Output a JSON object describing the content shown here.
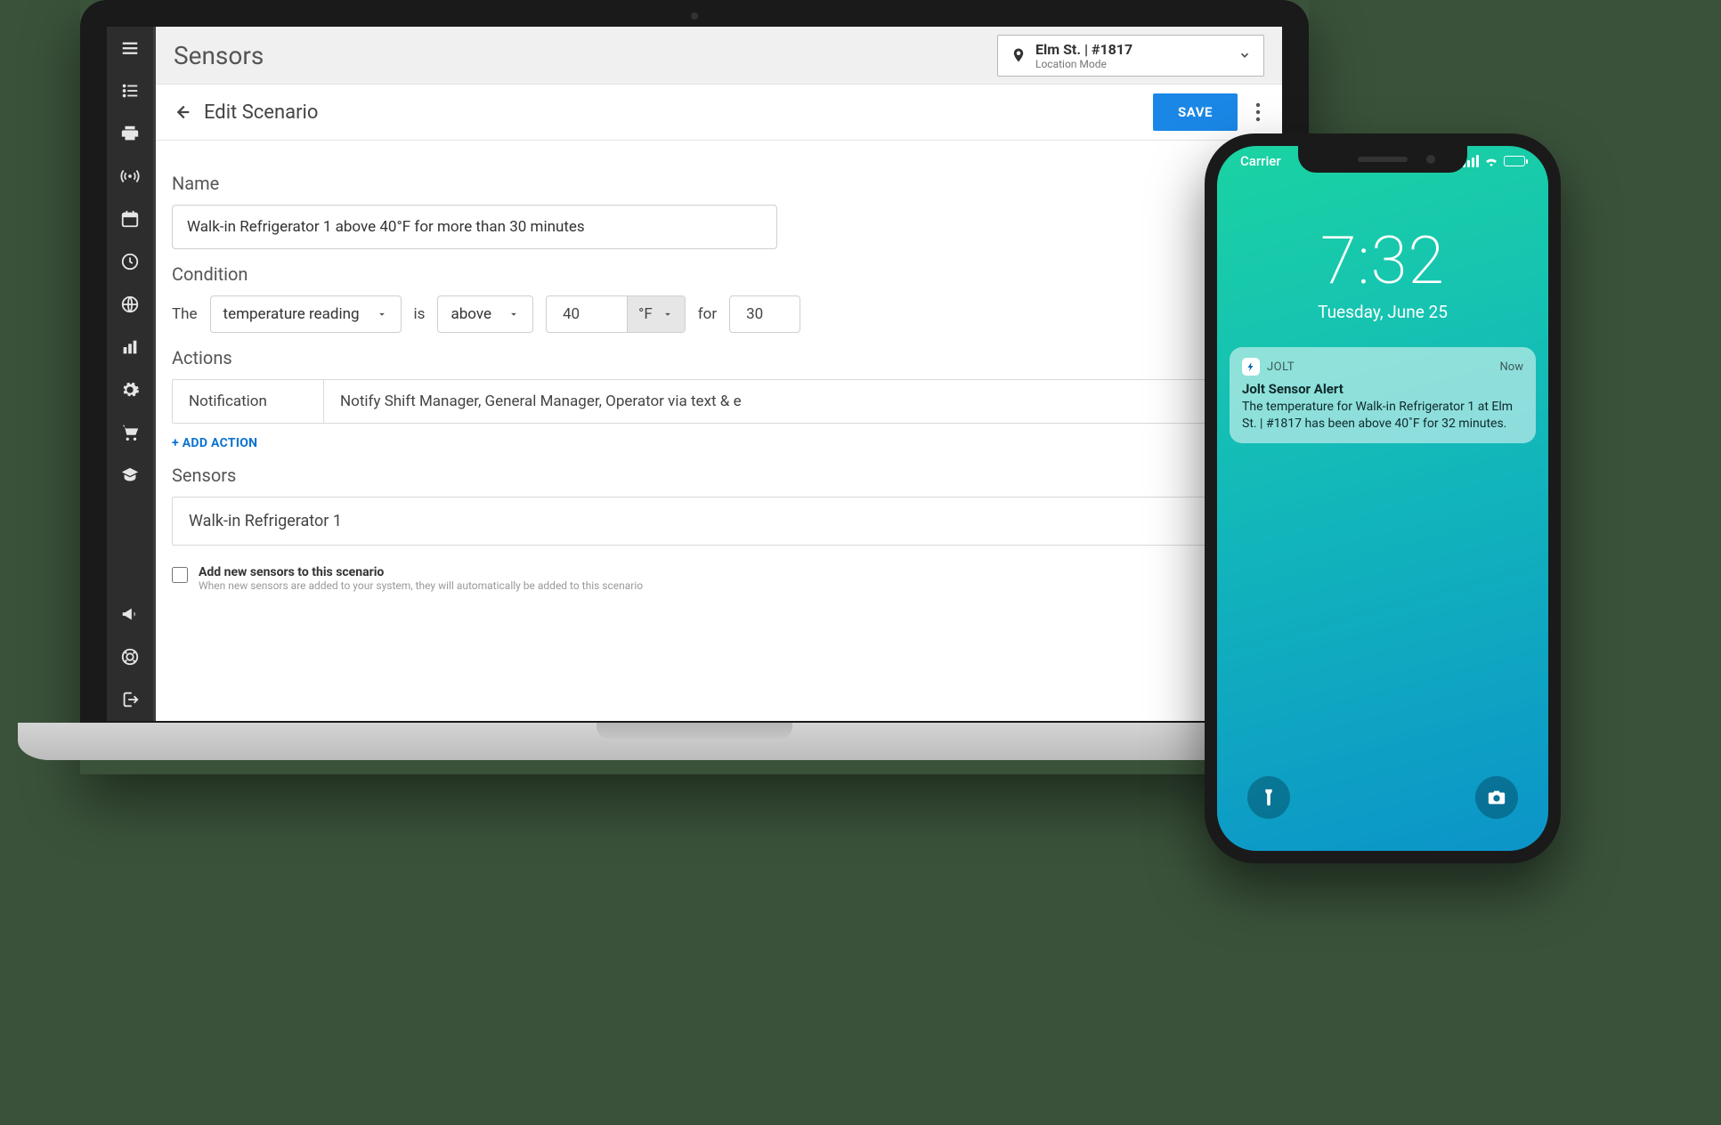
{
  "topbar": {
    "title": "Sensors"
  },
  "location": {
    "title": "Elm St. | #1817",
    "sub": "Location Mode"
  },
  "subheader": {
    "title": "Edit Scenario",
    "save": "SAVE"
  },
  "sections": {
    "name_label": "Name",
    "condition_label": "Condition",
    "actions_label": "Actions",
    "sensors_label": "Sensors"
  },
  "form": {
    "name_value": "Walk-in Refrigerator 1 above 40°F for more than 30 minutes",
    "condition": {
      "the": "The",
      "metric": "temperature reading",
      "is": "is",
      "comparator": "above",
      "value": "40",
      "unit": "°F",
      "for": "for",
      "duration": "30"
    },
    "action_type": "Notification",
    "action_desc": "Notify Shift Manager, General Manager, Operator via text & e",
    "add_action": "+ ADD ACTION",
    "sensor_selected": "Walk-in Refrigerator 1",
    "add_new_sensors_checked": false,
    "add_new_sensors_title": "Add new sensors to this scenario",
    "add_new_sensors_sub": "When new sensors are added to your system, they will automatically be added to this scenario"
  },
  "sidebar": {
    "items": [
      "menu-icon",
      "checklist-icon",
      "printer-icon",
      "broadcast-icon",
      "calendar-icon",
      "clock-icon",
      "globe-icon",
      "chart-icon",
      "gear-icon",
      "cart-icon",
      "education-icon"
    ],
    "bottom_items": [
      "megaphone-icon",
      "help-icon",
      "logout-icon"
    ]
  },
  "phone": {
    "carrier": "Carrier",
    "time": "7:32",
    "date": "Tuesday, June 25",
    "notification": {
      "app": "JOLT",
      "when": "Now",
      "title": "Jolt Sensor Alert",
      "body": "The temperature for Walk-in Refrigerator 1 at Elm St. | #1817 has been above 40˚F for 32 minutes."
    }
  }
}
